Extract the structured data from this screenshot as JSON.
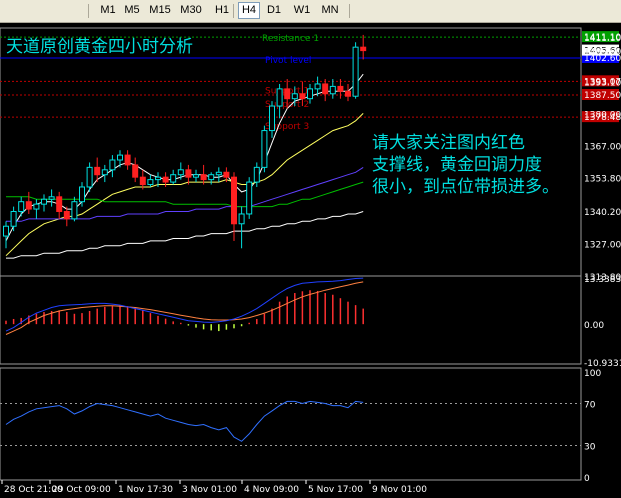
{
  "toolbar": {
    "timeframes": [
      "M1",
      "M5",
      "M15",
      "M30",
      "H1",
      "H4",
      "D1",
      "W1",
      "MN"
    ],
    "active": "H4"
  },
  "chart_title": "天道原创黄金四小时分析",
  "annotation": [
    "请大家关注图内红色",
    "支撑线，黄金回调力度",
    "很小，到点位带损进多。"
  ],
  "levels": [
    {
      "label": "Resistance 1",
      "price": 1411.1,
      "color": "#00a000"
    },
    {
      "label": "Pivot level",
      "price": 1402.6,
      "color": "#0000ff"
    },
    {
      "label": "Support 1",
      "price": 1393.07,
      "color": "#c00000"
    },
    {
      "label": "Support 2",
      "price": 1387.5,
      "color": "#c00000"
    },
    {
      "label": "Support 3",
      "price": 1378.48,
      "color": "#c00000"
    }
  ],
  "current_price": 1405.6,
  "colors": {
    "up": "#00e0e0",
    "down": "#ff2020",
    "axis": "#ffffff",
    "grid": "#4a4a4a",
    "ma_fast": "#ffffff",
    "ma_mid": "#ffff60",
    "ma_slow": "#6040ff",
    "ma_long": "#00c000",
    "ma_vlong": "#ffffff",
    "rsi": "#3070ff",
    "macd_signal": "#ff8040",
    "macd_main": "#2040ff"
  },
  "chart_data": [
    {
      "type": "candlestick",
      "panel": "price",
      "ylim": [
        1308,
        1414
      ],
      "y_ticks": [
        1313.8,
        1327.0,
        1340.2,
        1353.8,
        1367.0,
        1380.0,
        1393.1,
        1405.6,
        1411.1
      ],
      "x_tick_labels": [
        "28 Oct 21:00",
        "29 Oct 09:00",
        "1 Nov 17:30",
        "3 Nov 01:00",
        "4 Nov 09:00",
        "5 Nov 17:00",
        "9 Nov 01:00"
      ],
      "candles": [
        {
          "o": 1330,
          "h": 1336,
          "c": 1334,
          "l": 1325
        },
        {
          "o": 1334,
          "h": 1342,
          "c": 1340,
          "l": 1332
        },
        {
          "o": 1340,
          "h": 1346,
          "c": 1344,
          "l": 1338
        },
        {
          "o": 1344,
          "h": 1348,
          "c": 1341,
          "l": 1339
        },
        {
          "o": 1341,
          "h": 1345,
          "c": 1343,
          "l": 1337
        },
        {
          "o": 1343,
          "h": 1347,
          "c": 1345,
          "l": 1340
        },
        {
          "o": 1345,
          "h": 1349,
          "c": 1346,
          "l": 1342
        },
        {
          "o": 1346,
          "h": 1348,
          "c": 1340,
          "l": 1337
        },
        {
          "o": 1340,
          "h": 1342,
          "c": 1337,
          "l": 1334
        },
        {
          "o": 1337,
          "h": 1346,
          "c": 1344,
          "l": 1336
        },
        {
          "o": 1344,
          "h": 1352,
          "c": 1350,
          "l": 1342
        },
        {
          "o": 1350,
          "h": 1360,
          "c": 1358,
          "l": 1348
        },
        {
          "o": 1358,
          "h": 1362,
          "c": 1355,
          "l": 1352
        },
        {
          "o": 1355,
          "h": 1359,
          "c": 1357,
          "l": 1352
        },
        {
          "o": 1357,
          "h": 1363,
          "c": 1361,
          "l": 1354
        },
        {
          "o": 1361,
          "h": 1365,
          "c": 1363,
          "l": 1358
        },
        {
          "o": 1363,
          "h": 1365,
          "c": 1359,
          "l": 1357
        },
        {
          "o": 1359,
          "h": 1362,
          "c": 1354,
          "l": 1352
        },
        {
          "o": 1354,
          "h": 1357,
          "c": 1351,
          "l": 1349
        },
        {
          "o": 1351,
          "h": 1355,
          "c": 1353,
          "l": 1350
        },
        {
          "o": 1353,
          "h": 1356,
          "c": 1354,
          "l": 1350
        },
        {
          "o": 1354,
          "h": 1356,
          "c": 1352,
          "l": 1350
        },
        {
          "o": 1352,
          "h": 1357,
          "c": 1355,
          "l": 1351
        },
        {
          "o": 1355,
          "h": 1360,
          "c": 1357,
          "l": 1353
        },
        {
          "o": 1357,
          "h": 1359,
          "c": 1354,
          "l": 1351
        },
        {
          "o": 1354,
          "h": 1357,
          "c": 1355,
          "l": 1352
        },
        {
          "o": 1355,
          "h": 1359,
          "c": 1353,
          "l": 1351
        },
        {
          "o": 1353,
          "h": 1356,
          "c": 1355,
          "l": 1351
        },
        {
          "o": 1355,
          "h": 1358,
          "c": 1356,
          "l": 1352
        },
        {
          "o": 1356,
          "h": 1358,
          "c": 1354,
          "l": 1352
        },
        {
          "o": 1354,
          "h": 1356,
          "c": 1335,
          "l": 1328
        },
        {
          "o": 1335,
          "h": 1342,
          "c": 1339,
          "l": 1325
        },
        {
          "o": 1339,
          "h": 1354,
          "c": 1352,
          "l": 1337
        },
        {
          "o": 1352,
          "h": 1360,
          "c": 1358,
          "l": 1350
        },
        {
          "o": 1358,
          "h": 1375,
          "c": 1373,
          "l": 1356
        },
        {
          "o": 1373,
          "h": 1385,
          "c": 1383,
          "l": 1370
        },
        {
          "o": 1383,
          "h": 1392,
          "c": 1390,
          "l": 1378
        },
        {
          "o": 1390,
          "h": 1394,
          "c": 1386,
          "l": 1382
        },
        {
          "o": 1386,
          "h": 1391,
          "c": 1388,
          "l": 1383
        },
        {
          "o": 1388,
          "h": 1393,
          "c": 1386,
          "l": 1383
        },
        {
          "o": 1386,
          "h": 1392,
          "c": 1390,
          "l": 1384
        },
        {
          "o": 1390,
          "h": 1395,
          "c": 1392,
          "l": 1387
        },
        {
          "o": 1392,
          "h": 1394,
          "c": 1388,
          "l": 1385
        },
        {
          "o": 1388,
          "h": 1394,
          "c": 1391,
          "l": 1386
        },
        {
          "o": 1391,
          "h": 1394,
          "c": 1389,
          "l": 1386
        },
        {
          "o": 1389,
          "h": 1392,
          "c": 1387,
          "l": 1385
        },
        {
          "o": 1387,
          "h": 1409,
          "c": 1407,
          "l": 1386
        },
        {
          "o": 1407,
          "h": 1412,
          "c": 1405.6,
          "l": 1402
        }
      ],
      "moving_averages": [
        {
          "color_key": "ma_fast",
          "values": [
            1328,
            1334,
            1339,
            1342,
            1343,
            1344,
            1344,
            1343,
            1341,
            1341,
            1344,
            1349,
            1353,
            1355,
            1357,
            1359,
            1360,
            1359,
            1357,
            1355,
            1354,
            1353,
            1353,
            1354,
            1355,
            1355,
            1355,
            1354,
            1354,
            1355,
            1351,
            1348,
            1349,
            1353,
            1360,
            1368,
            1376,
            1382,
            1385,
            1386,
            1387,
            1388,
            1389,
            1389,
            1389,
            1389,
            1392,
            1396
          ]
        },
        {
          "color_key": "ma_mid",
          "values": [
            1322,
            1325,
            1328,
            1331,
            1333,
            1335,
            1336,
            1337,
            1338,
            1338,
            1339,
            1341,
            1343,
            1345,
            1347,
            1348,
            1349,
            1350,
            1350,
            1350,
            1351,
            1351,
            1351,
            1351,
            1352,
            1352,
            1352,
            1352,
            1352,
            1353,
            1352,
            1351,
            1351,
            1352,
            1353,
            1355,
            1358,
            1361,
            1363,
            1365,
            1367,
            1369,
            1371,
            1373,
            1374,
            1375,
            1377,
            1380
          ]
        },
        {
          "color_key": "ma_slow",
          "values": [
            1336,
            1336,
            1336,
            1337,
            1337,
            1337,
            1337,
            1337,
            1337,
            1337,
            1337,
            1337,
            1338,
            1338,
            1338,
            1338,
            1339,
            1339,
            1339,
            1339,
            1339,
            1340,
            1340,
            1340,
            1340,
            1341,
            1341,
            1341,
            1341,
            1342,
            1342,
            1342,
            1342,
            1343,
            1344,
            1345,
            1346,
            1347,
            1348,
            1349,
            1350,
            1351,
            1352,
            1353,
            1354,
            1355,
            1356,
            1358
          ]
        },
        {
          "color_key": "ma_long",
          "values": [
            1346,
            1346,
            1346,
            1346,
            1345,
            1345,
            1345,
            1345,
            1345,
            1345,
            1345,
            1345,
            1345,
            1344,
            1344,
            1344,
            1344,
            1344,
            1344,
            1344,
            1344,
            1344,
            1343,
            1343,
            1343,
            1343,
            1343,
            1343,
            1343,
            1343,
            1342,
            1342,
            1342,
            1342,
            1342,
            1342,
            1343,
            1343,
            1344,
            1345,
            1345,
            1346,
            1347,
            1348,
            1349,
            1350,
            1351,
            1352
          ]
        },
        {
          "color_key": "ma_vlong",
          "values": [
            1321,
            1321,
            1322,
            1322,
            1322,
            1323,
            1323,
            1323,
            1324,
            1324,
            1324,
            1325,
            1325,
            1326,
            1326,
            1326,
            1327,
            1327,
            1327,
            1328,
            1328,
            1328,
            1329,
            1329,
            1329,
            1330,
            1330,
            1331,
            1331,
            1331,
            1332,
            1332,
            1332,
            1333,
            1333,
            1334,
            1334,
            1335,
            1335,
            1336,
            1336,
            1337,
            1337,
            1338,
            1338,
            1339,
            1339,
            1340
          ]
        }
      ]
    },
    {
      "type": "macd",
      "panel": "macd",
      "y_ticks": [
        13.3383,
        0.0,
        -10.9331
      ],
      "ylim": [
        -10.9331,
        13.3383
      ],
      "histogram": [
        1,
        1.5,
        1.8,
        2.5,
        3,
        3.5,
        3.8,
        4,
        3.5,
        3,
        3.2,
        3.8,
        4.5,
        5,
        5.2,
        5.4,
        5.2,
        4.8,
        4,
        3.2,
        2.4,
        1.6,
        0.8,
        0.4,
        -0.4,
        -1,
        -1.5,
        -1.8,
        -2,
        -1.6,
        -1.2,
        -0.6,
        0.4,
        1.5,
        3,
        4.5,
        6.5,
        8,
        9,
        9.5,
        9.8,
        9.6,
        9,
        8.5,
        7.5,
        6.5,
        5.5,
        4.5
      ],
      "main": [
        -2,
        -1,
        0.5,
        2,
        3.2,
        4,
        4.8,
        5.3,
        5.5,
        5.6,
        5.7,
        5.9,
        6,
        6,
        5.8,
        5.5,
        5,
        4.5,
        4,
        3.5,
        3,
        2.5,
        2,
        1.5,
        1,
        0.8,
        0.6,
        0.5,
        0.7,
        1,
        1.5,
        2.3,
        3.3,
        4.5,
        6,
        7.5,
        9,
        10.3,
        11.2,
        11.8,
        12,
        12.2,
        12.3,
        12.4,
        12.6,
        12.9,
        13.2,
        13.3
      ],
      "signal": [
        -3,
        -2,
        -1,
        0.5,
        1.5,
        2.5,
        3.2,
        3.8,
        4.2,
        4.5,
        4.8,
        5,
        5.2,
        5.3,
        5.3,
        5.2,
        5,
        4.8,
        4.5,
        4.2,
        3.8,
        3.4,
        3,
        2.6,
        2.2,
        1.8,
        1.5,
        1.3,
        1.2,
        1.2,
        1.3,
        1.5,
        1.9,
        2.5,
        3.2,
        4,
        5,
        6,
        7,
        7.9,
        8.6,
        9.2,
        9.8,
        10.3,
        10.8,
        11.3,
        11.8,
        12.2
      ]
    },
    {
      "type": "line",
      "panel": "rsi",
      "y_ticks": [
        100,
        70,
        30,
        0
      ],
      "ylim": [
        0,
        100
      ],
      "values": [
        50,
        55,
        58,
        62,
        65,
        66,
        67,
        68,
        65,
        60,
        63,
        67,
        70,
        69,
        68,
        66,
        64,
        62,
        60,
        58,
        60,
        56,
        54,
        52,
        50,
        49,
        50,
        47,
        45,
        47,
        38,
        34,
        41,
        50,
        58,
        63,
        68,
        72,
        72,
        70,
        72,
        71,
        70,
        68,
        68,
        66,
        72,
        71
      ]
    }
  ]
}
